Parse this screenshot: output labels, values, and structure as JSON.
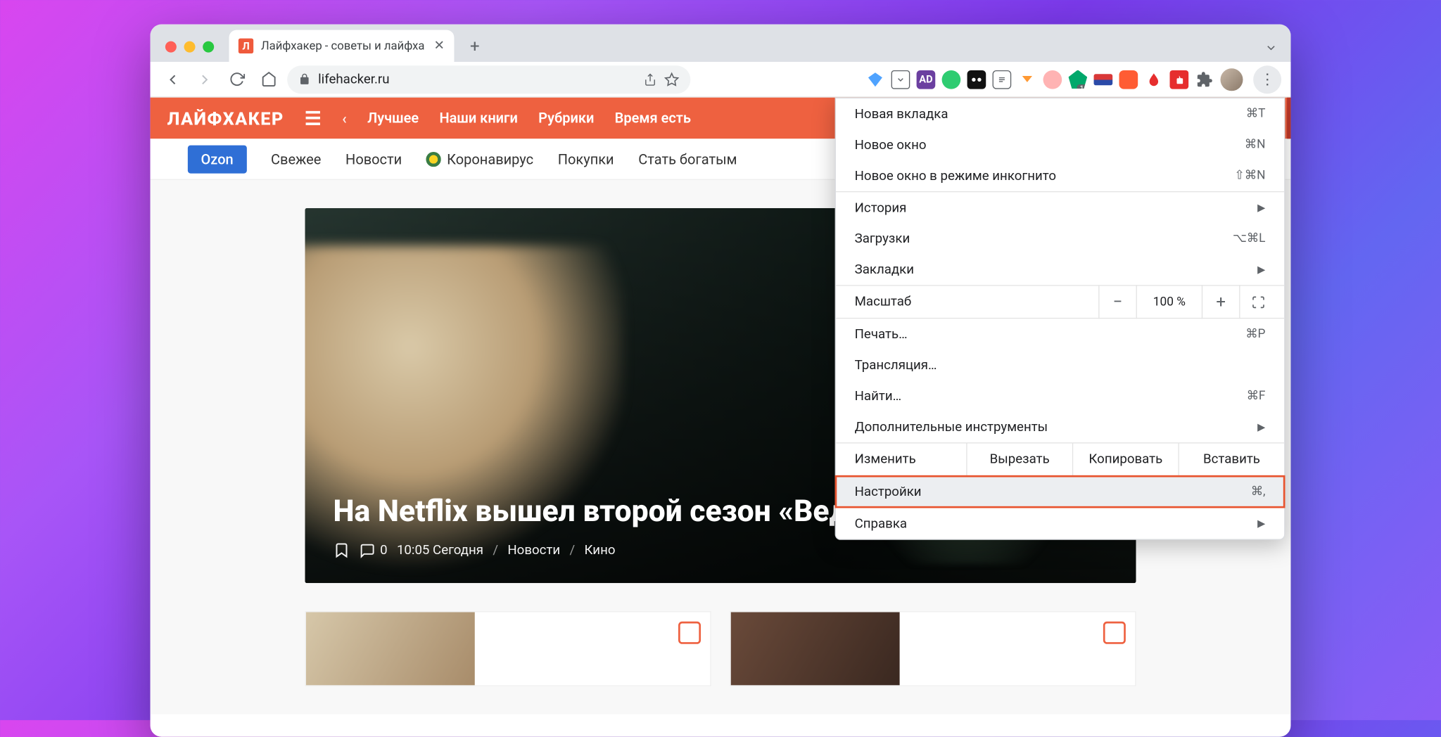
{
  "tab": {
    "title": "Лайфхакер - советы и лайфха",
    "favicon_letter": "Л"
  },
  "toolbar": {
    "url": "lifehacker.ru"
  },
  "sitebar": {
    "logo": "ЛАЙФХАКЕР",
    "items": [
      "Лучшее",
      "Наши книги",
      "Рубрики",
      "Время есть"
    ]
  },
  "subnav": {
    "pill": "Ozon",
    "items": [
      "Свежее",
      "Новости",
      "Коронавирус",
      "Покупки",
      "Стать богатым"
    ]
  },
  "hero": {
    "title": "На Netflix вышел второй сезон «Ведьмака»",
    "comments": "0",
    "time": "10:05 Сегодня",
    "cat1": "Новости",
    "cat2": "Кино"
  },
  "menu": {
    "new_tab": "Новая вкладка",
    "new_tab_sc": "⌘T",
    "new_window": "Новое окно",
    "new_window_sc": "⌘N",
    "incognito": "Новое окно в режиме инкогнито",
    "incognito_sc": "⇧⌘N",
    "history": "История",
    "downloads": "Загрузки",
    "downloads_sc": "⌥⌘L",
    "bookmarks": "Закладки",
    "zoom": "Масштаб",
    "zoom_value": "100 %",
    "print": "Печать…",
    "print_sc": "⌘P",
    "cast": "Трансляция…",
    "find": "Найти…",
    "find_sc": "⌘F",
    "more_tools": "Дополнительные инструменты",
    "edit": "Изменить",
    "cut": "Вырезать",
    "copy": "Копировать",
    "paste": "Вставить",
    "settings": "Настройки",
    "settings_sc": "⌘,",
    "help": "Справка"
  }
}
